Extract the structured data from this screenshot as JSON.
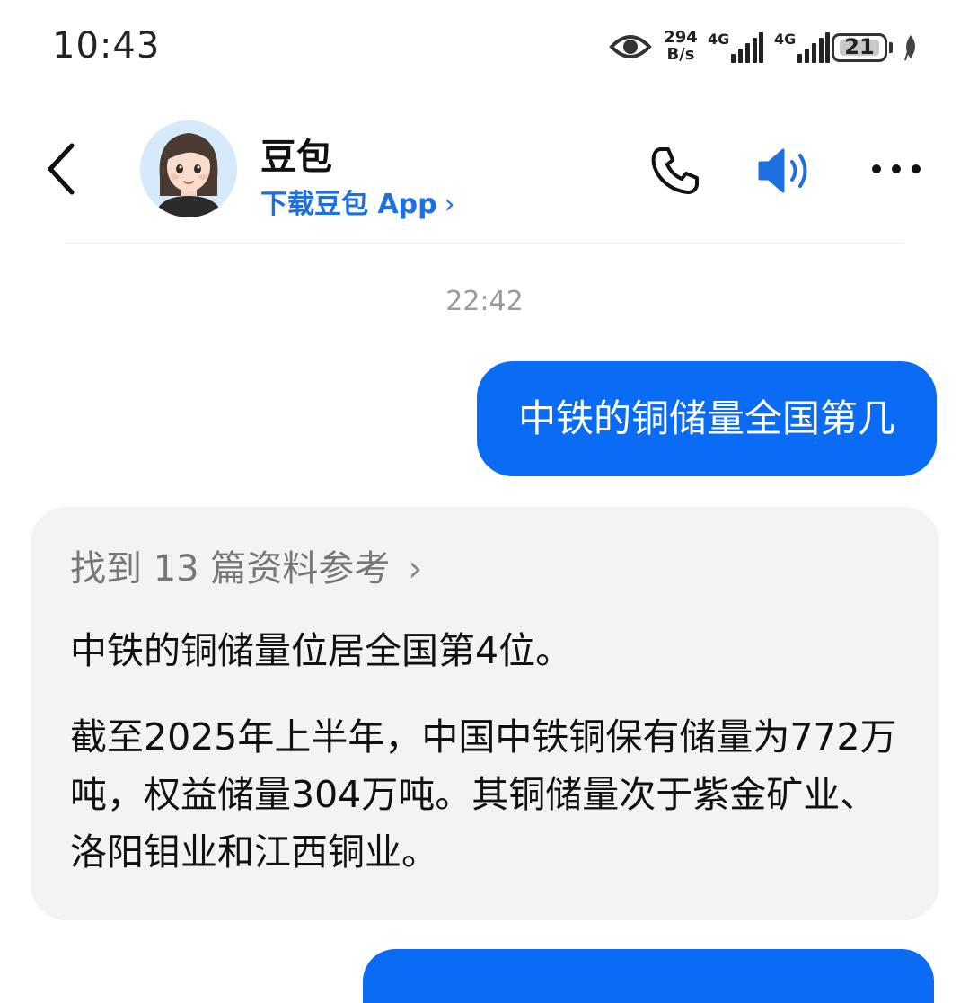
{
  "status_bar": {
    "time": "10:43",
    "net_speed_value": "294",
    "net_speed_unit": "B/s",
    "signal_1_label": "4G",
    "signal_2_label": "4G",
    "battery_level": "21",
    "icons": [
      "eye-icon",
      "signal-icon",
      "battery-icon",
      "leaf-icon"
    ]
  },
  "header": {
    "contact_name": "豆包",
    "download_label": "下载豆包 App",
    "download_chevron": "›",
    "icons": [
      "back-icon",
      "avatar",
      "phone-icon",
      "speaker-icon",
      "more-icon"
    ]
  },
  "chat": {
    "timestamp": "22:42",
    "messages": [
      {
        "role": "user",
        "text": "中铁的铜储量全国第几"
      },
      {
        "role": "assistant",
        "sources_label": "找到 13 篇资料参考",
        "sources_chevron": "›",
        "paragraphs": [
          "中铁的铜储量位居全国第4位。",
          "截至2025年上半年，中国中铁铜保有储量为772万吨，权益储量304万吨。其铜储量次于紫金矿业、洛阳钼业和江西铜业。"
        ]
      }
    ]
  },
  "colors": {
    "accent": "#0a6cf5",
    "link": "#1e6fe0",
    "bot_bubble_bg": "#f3f3f3",
    "muted_text": "#9a9a9a"
  }
}
